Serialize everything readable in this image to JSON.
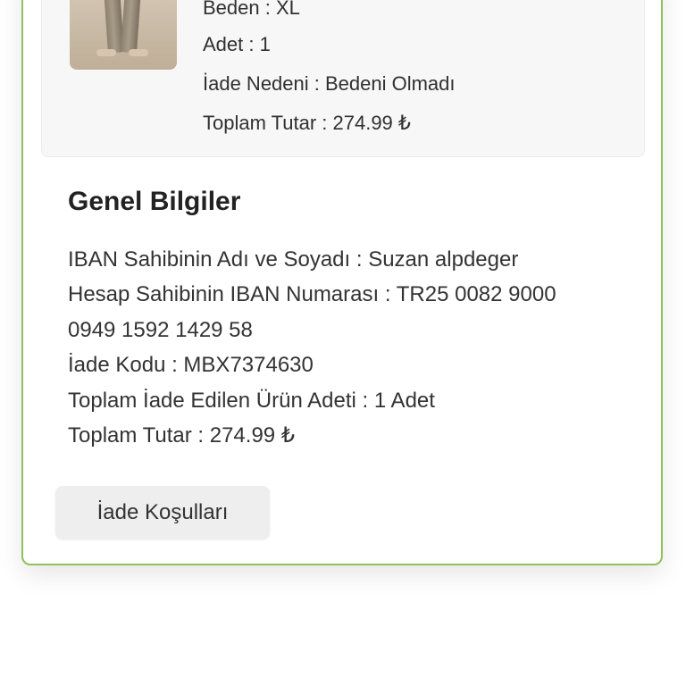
{
  "product": {
    "size_line": "Beden : XL",
    "quantity_line": "Adet : 1",
    "return_reason_line": "İade Nedeni : Bedeni Olmadı",
    "total_line": "Toplam Tutar : 274.99 ₺"
  },
  "general_info": {
    "title": "Genel Bilgiler",
    "iban_owner_line": "IBAN Sahibinin Adı ve Soyadı : Suzan alpdeger",
    "iban_number_line_1": "Hesap Sahibinin IBAN Numarası : TR25 0082 9000",
    "iban_number_line_2": "0949 1592 1429 58",
    "return_code_line": "İade Kodu : MBX7374630",
    "returned_items_line": "Toplam İade Edilen Ürün Adeti : 1 Adet",
    "total_amount_line": "Toplam Tutar : 274.99 ₺"
  },
  "actions": {
    "return_conditions_label": "İade Koşulları"
  },
  "colors": {
    "card_border": "#8fc25a",
    "product_panel": "#f7f7f7",
    "button_background": "#eeeeee",
    "text": "#333333"
  }
}
